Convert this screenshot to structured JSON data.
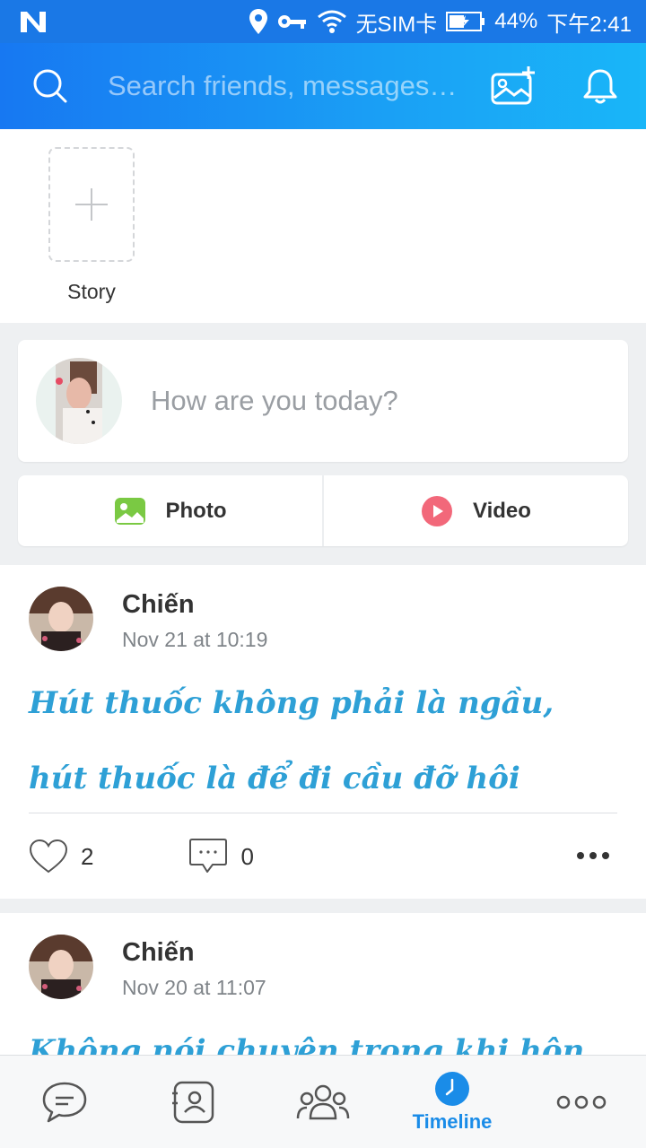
{
  "status_bar": {
    "carrier_text": "无SIM卡",
    "battery": "44%",
    "time": "下午2:41"
  },
  "header": {
    "search_placeholder": "Search friends, messages…"
  },
  "stories": {
    "add_label": "Story"
  },
  "composer": {
    "prompt": "How are you today?",
    "photo_label": "Photo",
    "video_label": "Video"
  },
  "posts": [
    {
      "author": "Chiến",
      "time": "Nov 21 at 10:19",
      "text": "Hút thuốc không phải là ngầu, hút thuốc là để đi cầu đỡ hôi",
      "likes": "2",
      "comments": "0"
    },
    {
      "author": "Chiến",
      "time": "Nov 20 at 11:07",
      "text": "Không nói chuyện trong khi hôn."
    }
  ],
  "bottom_nav": {
    "items": [
      {
        "icon": "chat-icon"
      },
      {
        "icon": "contacts-icon"
      },
      {
        "icon": "groups-icon"
      },
      {
        "icon": "timeline-icon",
        "label": "Timeline",
        "active": true
      },
      {
        "icon": "more-icon"
      }
    ]
  },
  "colors": {
    "accent": "#1a8ce8",
    "header_start": "#1778f2",
    "header_end": "#19b6f8",
    "post_text": "#2ea0d6"
  }
}
